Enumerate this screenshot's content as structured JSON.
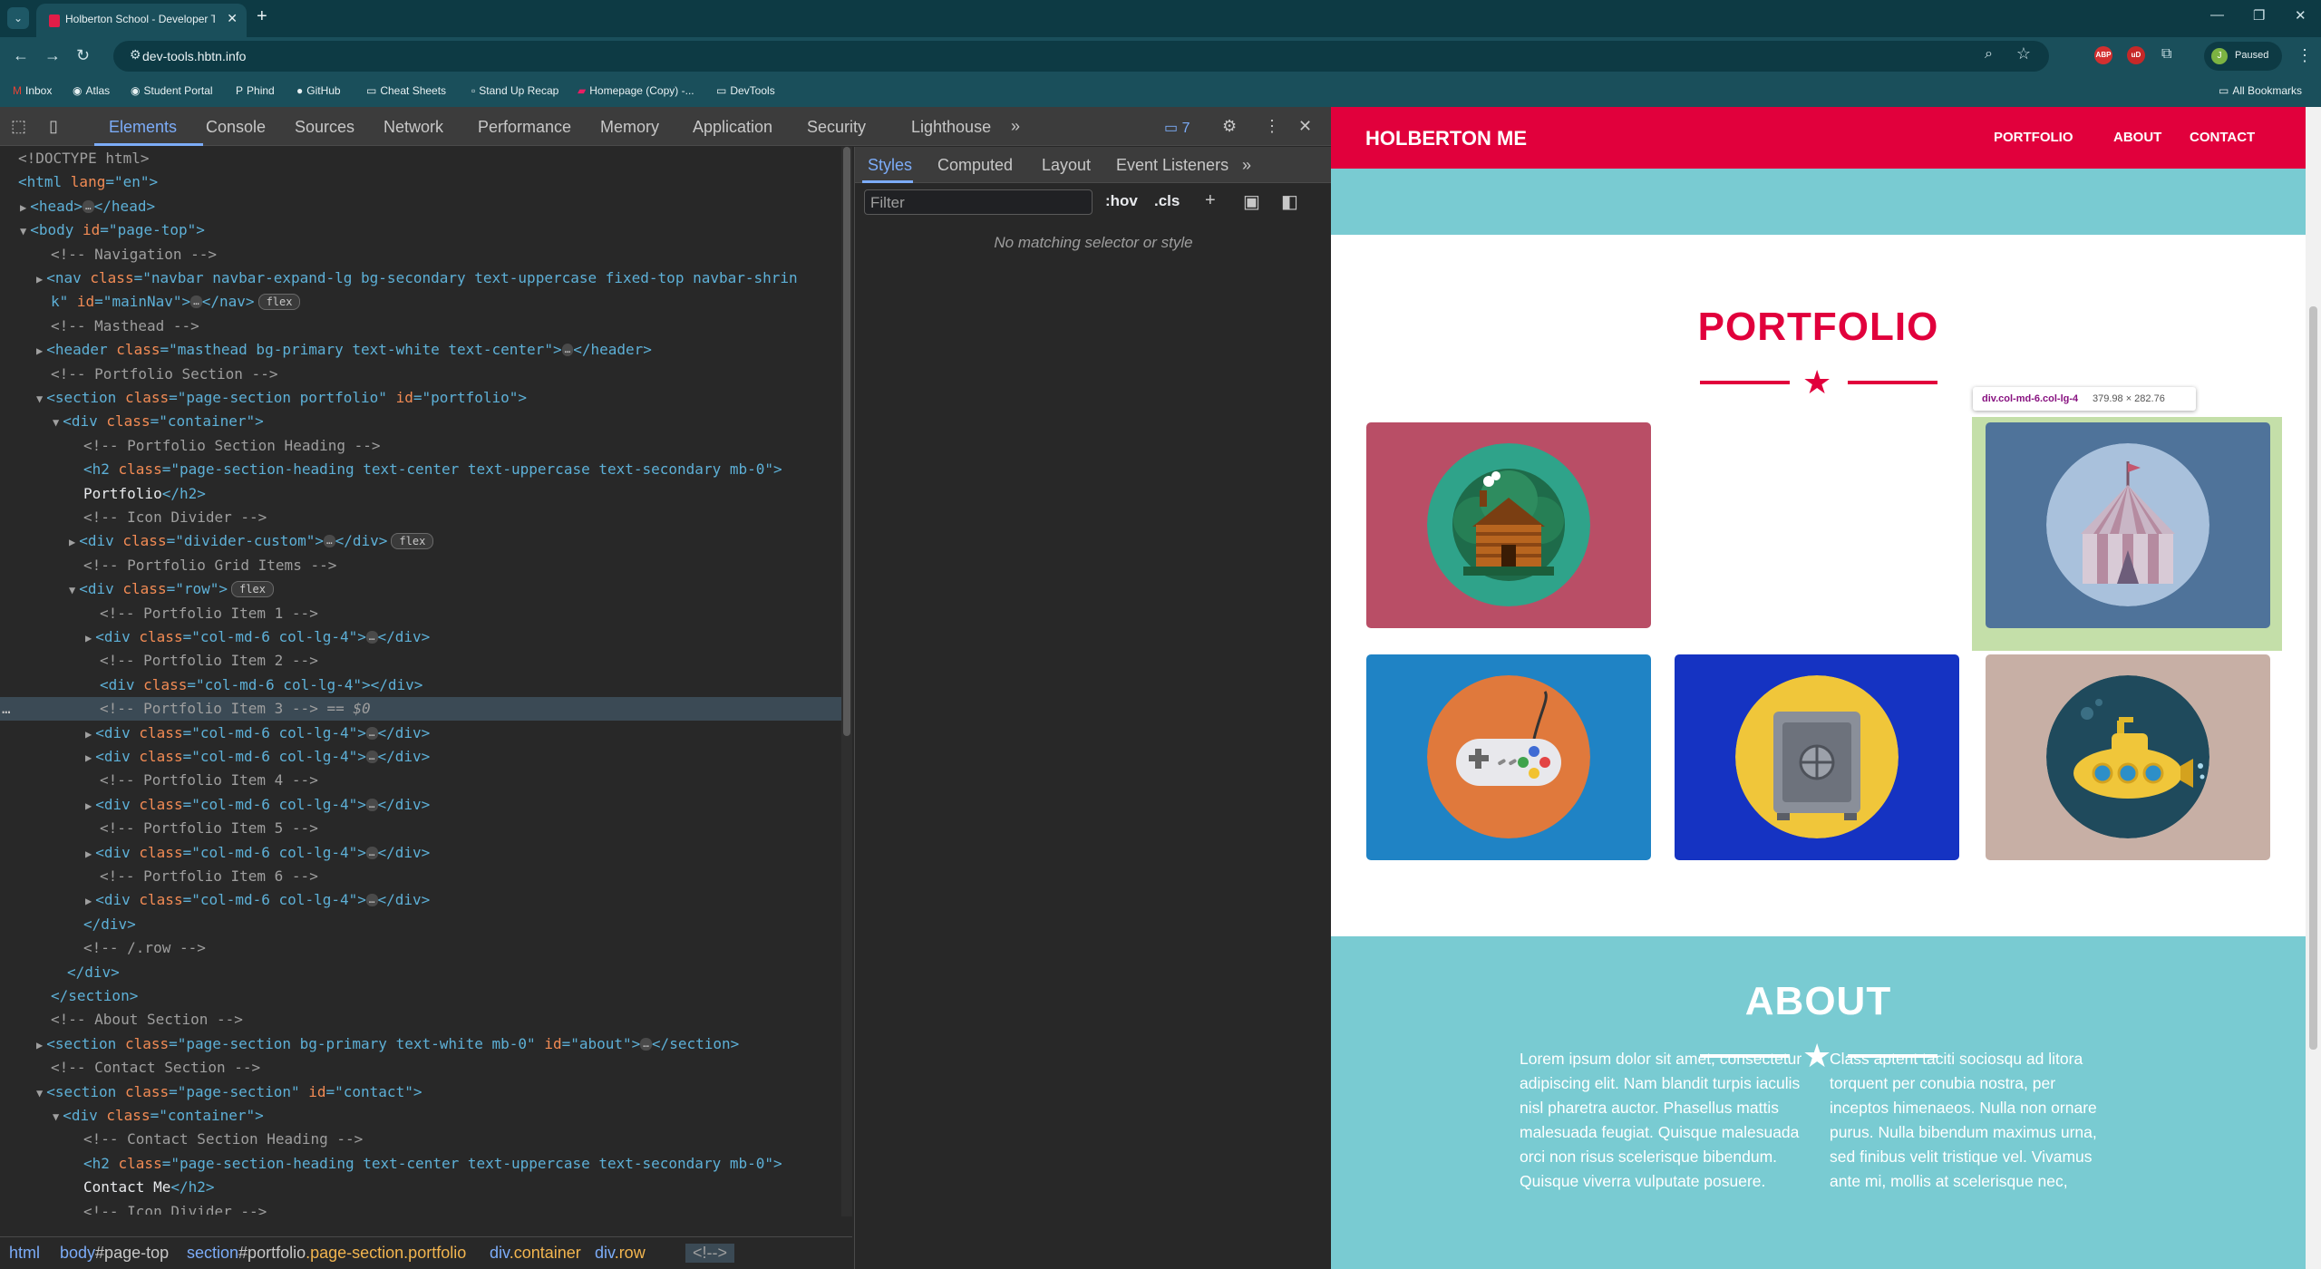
{
  "browser": {
    "tab_title": "Holberton School - Developer Tools",
    "url": "dev-tools.hbtn.info",
    "profile_initial": "J",
    "profile_status": "Paused",
    "extensions": [
      "ABP",
      "uD"
    ],
    "bookmarks": [
      "Inbox",
      "Atlas",
      "Student Portal",
      "Phind",
      "GitHub",
      "Cheat Sheets",
      "Stand Up Recap",
      "Homepage (Copy) -...",
      "DevTools"
    ],
    "all_bookmarks": "All Bookmarks"
  },
  "devtools": {
    "tabs": [
      "Elements",
      "Console",
      "Sources",
      "Network",
      "Performance",
      "Memory",
      "Application",
      "Security",
      "Lighthouse"
    ],
    "active_tab": "Elements",
    "issues_count": "7",
    "styles_tabs": [
      "Styles",
      "Computed",
      "Layout",
      "Event Listeners"
    ],
    "filter_placeholder": "Filter",
    "hov": ":hov",
    "cls": ".cls",
    "no_match": "No matching selector or style",
    "breadcrumbs": [
      {
        "a": "html",
        "b": "",
        "c": ""
      },
      {
        "a": "body",
        "b": "#page-top",
        "c": ""
      },
      {
        "a": "section",
        "b": "#portfolio",
        "c": ".page-section.portfolio"
      },
      {
        "a": "div",
        "b": "",
        "c": ".container"
      },
      {
        "a": "div",
        "b": "",
        "c": ".row"
      },
      {
        "a": "<!-->",
        "b": "",
        "c": ""
      }
    ],
    "dom": [
      {
        "i": 0,
        "t": "",
        "s": [
          [
            "c",
            "<!DOCTYPE html>"
          ]
        ]
      },
      {
        "i": 0,
        "t": "",
        "s": [
          [
            "g",
            "<html "
          ],
          [
            "a",
            "lang"
          ],
          [
            "g",
            "=\"en\">"
          ]
        ]
      },
      {
        "i": 1,
        "t": "c",
        "s": [
          [
            "g",
            "<head>"
          ],
          [
            "e",
            "…"
          ],
          [
            "g",
            "</head>"
          ]
        ]
      },
      {
        "i": 1,
        "t": "o",
        "s": [
          [
            "g",
            "<body "
          ],
          [
            "a",
            "id"
          ],
          [
            "g",
            "=\"page-top\">"
          ]
        ]
      },
      {
        "i": 2,
        "t": "",
        "s": [
          [
            "c",
            "<!-- Navigation -->"
          ]
        ]
      },
      {
        "i": 2,
        "t": "c",
        "s": [
          [
            "g",
            "<nav "
          ],
          [
            "a",
            "class"
          ],
          [
            "g",
            "=\"navbar navbar-expand-lg bg-secondary text-uppercase fixed-top navbar-shrin"
          ]
        ]
      },
      {
        "i": 2,
        "t": "",
        "s": [
          [
            "g",
            "k\" "
          ],
          [
            "a",
            "id"
          ],
          [
            "g",
            "=\"mainNav\">"
          ],
          [
            "e",
            "…"
          ],
          [
            "g",
            "</nav>"
          ],
          [
            "b",
            "flex"
          ]
        ]
      },
      {
        "i": 2,
        "t": "",
        "s": [
          [
            "c",
            "<!-- Masthead -->"
          ]
        ]
      },
      {
        "i": 2,
        "t": "c",
        "s": [
          [
            "g",
            "<header "
          ],
          [
            "a",
            "class"
          ],
          [
            "g",
            "=\"masthead bg-primary text-white text-center\">"
          ],
          [
            "e",
            "…"
          ],
          [
            "g",
            "</header>"
          ]
        ]
      },
      {
        "i": 2,
        "t": "",
        "s": [
          [
            "c",
            "<!-- Portfolio Section -->"
          ]
        ]
      },
      {
        "i": 2,
        "t": "o",
        "s": [
          [
            "g",
            "<section "
          ],
          [
            "a",
            "class"
          ],
          [
            "g",
            "=\"page-section portfolio\" "
          ],
          [
            "a",
            "id"
          ],
          [
            "g",
            "=\"portfolio\">"
          ]
        ]
      },
      {
        "i": 3,
        "t": "o",
        "s": [
          [
            "g",
            "<div "
          ],
          [
            "a",
            "class"
          ],
          [
            "g",
            "=\"container\">"
          ]
        ]
      },
      {
        "i": 4,
        "t": "",
        "s": [
          [
            "c",
            "<!-- Portfolio Section Heading -->"
          ]
        ]
      },
      {
        "i": 4,
        "t": "",
        "s": [
          [
            "g",
            "<h2 "
          ],
          [
            "a",
            "class"
          ],
          [
            "g",
            "=\"page-section-heading text-center text-uppercase text-secondary mb-0\">"
          ]
        ]
      },
      {
        "i": 4,
        "t": "",
        "s": [
          [
            "x",
            "Portfolio"
          ],
          [
            "g",
            "</h2>"
          ]
        ]
      },
      {
        "i": 4,
        "t": "",
        "s": [
          [
            "c",
            "<!-- Icon Divider -->"
          ]
        ]
      },
      {
        "i": 4,
        "t": "c",
        "s": [
          [
            "g",
            "<div "
          ],
          [
            "a",
            "class"
          ],
          [
            "g",
            "=\"divider-custom\">"
          ],
          [
            "e",
            "…"
          ],
          [
            "g",
            "</div>"
          ],
          [
            "b",
            "flex"
          ]
        ]
      },
      {
        "i": 4,
        "t": "",
        "s": [
          [
            "c",
            "<!-- Portfolio Grid Items -->"
          ]
        ]
      },
      {
        "i": 4,
        "t": "o",
        "s": [
          [
            "g",
            "<div "
          ],
          [
            "a",
            "class"
          ],
          [
            "g",
            "=\"row\">"
          ],
          [
            "b",
            "flex"
          ]
        ]
      },
      {
        "i": 5,
        "t": "",
        "s": [
          [
            "c",
            "<!-- Portfolio Item 1 -->"
          ]
        ]
      },
      {
        "i": 5,
        "t": "c",
        "s": [
          [
            "g",
            "<div "
          ],
          [
            "a",
            "class"
          ],
          [
            "g",
            "=\"col-md-6 col-lg-4\">"
          ],
          [
            "e",
            "…"
          ],
          [
            "g",
            "</div>"
          ]
        ]
      },
      {
        "i": 5,
        "t": "",
        "s": [
          [
            "c",
            "<!-- Portfolio Item 2 -->"
          ]
        ]
      },
      {
        "i": 5,
        "t": "",
        "s": [
          [
            "g",
            "<div "
          ],
          [
            "a",
            "class"
          ],
          [
            "g",
            "=\"col-md-6 col-lg-4\"></div>"
          ]
        ]
      },
      {
        "i": 5,
        "t": "",
        "sel": true,
        "s": [
          [
            "c",
            "<!-- Portfolio Item 3 -->"
          ],
          [
            "d",
            " == $0"
          ]
        ]
      },
      {
        "i": 5,
        "t": "c",
        "s": [
          [
            "g",
            "<div "
          ],
          [
            "a",
            "class"
          ],
          [
            "g",
            "=\"col-md-6 col-lg-4\">"
          ],
          [
            "e",
            "…"
          ],
          [
            "g",
            "</div>"
          ]
        ]
      },
      {
        "i": 5,
        "t": "c",
        "s": [
          [
            "g",
            "<div "
          ],
          [
            "a",
            "class"
          ],
          [
            "g",
            "=\"col-md-6 col-lg-4\">"
          ],
          [
            "e",
            "…"
          ],
          [
            "g",
            "</div>"
          ]
        ]
      },
      {
        "i": 5,
        "t": "",
        "s": [
          [
            "c",
            "<!-- Portfolio Item 4 -->"
          ]
        ]
      },
      {
        "i": 5,
        "t": "c",
        "s": [
          [
            "g",
            "<div "
          ],
          [
            "a",
            "class"
          ],
          [
            "g",
            "=\"col-md-6 col-lg-4\">"
          ],
          [
            "e",
            "…"
          ],
          [
            "g",
            "</div>"
          ]
        ]
      },
      {
        "i": 5,
        "t": "",
        "s": [
          [
            "c",
            "<!-- Portfolio Item 5 -->"
          ]
        ]
      },
      {
        "i": 5,
        "t": "c",
        "s": [
          [
            "g",
            "<div "
          ],
          [
            "a",
            "class"
          ],
          [
            "g",
            "=\"col-md-6 col-lg-4\">"
          ],
          [
            "e",
            "…"
          ],
          [
            "g",
            "</div>"
          ]
        ]
      },
      {
        "i": 5,
        "t": "",
        "s": [
          [
            "c",
            "<!-- Portfolio Item 6 -->"
          ]
        ]
      },
      {
        "i": 5,
        "t": "c",
        "s": [
          [
            "g",
            "<div "
          ],
          [
            "a",
            "class"
          ],
          [
            "g",
            "=\"col-md-6 col-lg-4\">"
          ],
          [
            "e",
            "…"
          ],
          [
            "g",
            "</div>"
          ]
        ]
      },
      {
        "i": 4,
        "t": "",
        "s": [
          [
            "g",
            "</div>"
          ]
        ]
      },
      {
        "i": 4,
        "t": "",
        "s": [
          [
            "c",
            "<!-- /.row -->"
          ]
        ]
      },
      {
        "i": 3,
        "t": "",
        "s": [
          [
            "g",
            "</div>"
          ]
        ]
      },
      {
        "i": 2,
        "t": "",
        "s": [
          [
            "g",
            "</section>"
          ]
        ]
      },
      {
        "i": 2,
        "t": "",
        "s": [
          [
            "c",
            "<!-- About Section -->"
          ]
        ]
      },
      {
        "i": 2,
        "t": "c",
        "s": [
          [
            "g",
            "<section "
          ],
          [
            "a",
            "class"
          ],
          [
            "g",
            "=\"page-section bg-primary text-white mb-0\" "
          ],
          [
            "a",
            "id"
          ],
          [
            "g",
            "=\"about\">"
          ],
          [
            "e",
            "…"
          ],
          [
            "g",
            "</section>"
          ]
        ]
      },
      {
        "i": 2,
        "t": "",
        "s": [
          [
            "c",
            "<!-- Contact Section -->"
          ]
        ]
      },
      {
        "i": 2,
        "t": "o",
        "s": [
          [
            "g",
            "<section "
          ],
          [
            "a",
            "class"
          ],
          [
            "g",
            "=\"page-section\" "
          ],
          [
            "a",
            "id"
          ],
          [
            "g",
            "=\"contact\">"
          ]
        ]
      },
      {
        "i": 3,
        "t": "o",
        "s": [
          [
            "g",
            "<div "
          ],
          [
            "a",
            "class"
          ],
          [
            "g",
            "=\"container\">"
          ]
        ]
      },
      {
        "i": 4,
        "t": "",
        "s": [
          [
            "c",
            "<!-- Contact Section Heading -->"
          ]
        ]
      },
      {
        "i": 4,
        "t": "",
        "s": [
          [
            "g",
            "<h2 "
          ],
          [
            "a",
            "class"
          ],
          [
            "g",
            "=\"page-section-heading text-center text-uppercase text-secondary mb-0\">"
          ]
        ]
      },
      {
        "i": 4,
        "t": "",
        "s": [
          [
            "x",
            "Contact Me"
          ],
          [
            "g",
            "</h2>"
          ]
        ]
      },
      {
        "i": 4,
        "t": "",
        "s": [
          [
            "c",
            "<!-- Icon Divider -->"
          ]
        ]
      },
      {
        "i": 4,
        "t": "c",
        "s": [
          [
            "g",
            "<div "
          ],
          [
            "a",
            "class"
          ],
          [
            "g",
            "=\"divider-custom\">"
          ],
          [
            "e",
            "…"
          ],
          [
            "g",
            "</div>"
          ],
          [
            "b",
            "flex"
          ]
        ]
      },
      {
        "i": 4,
        "t": "",
        "s": [
          [
            "c",
            "<!-- Contact Section Form -->"
          ]
        ]
      }
    ]
  },
  "site": {
    "brand": "HOLBERTON ME",
    "nav": [
      "PORTFOLIO",
      "ABOUT",
      "CONTACT"
    ],
    "portfolio_title": "PORTFOLIO",
    "about_title": "ABOUT",
    "tooltip_name": "div.col-md-6.col-lg-4",
    "tooltip_dims": "379.98 × 282.76",
    "colors": {
      "primary": "#e1003c",
      "teal": "#79cbd2"
    },
    "portfolio_items": [
      {
        "name": "cabin",
        "bg": "#b94e66"
      },
      {
        "name": "circus-tent",
        "bg": "#4f739a"
      },
      {
        "name": "game-controller",
        "bg": "#1f83c5"
      },
      {
        "name": "safe",
        "bg": "#1533c2"
      },
      {
        "name": "submarine",
        "bg": "#c7afa5"
      }
    ],
    "about_left": "Lorem ipsum dolor sit amet, consectetur adipiscing elit. Nam blandit turpis iaculis nisl pharetra auctor. Phasellus mattis malesuada feugiat. Quisque malesuada orci non risus scelerisque bibendum. Quisque viverra vulputate posuere.",
    "about_right": "Class aptent taciti sociosqu ad litora torquent per conubia nostra, per inceptos himenaeos. Nulla non ornare purus. Nulla bibendum maximus urna, sed finibus velit tristique vel. Vivamus ante mi, mollis at scelerisque nec,"
  }
}
